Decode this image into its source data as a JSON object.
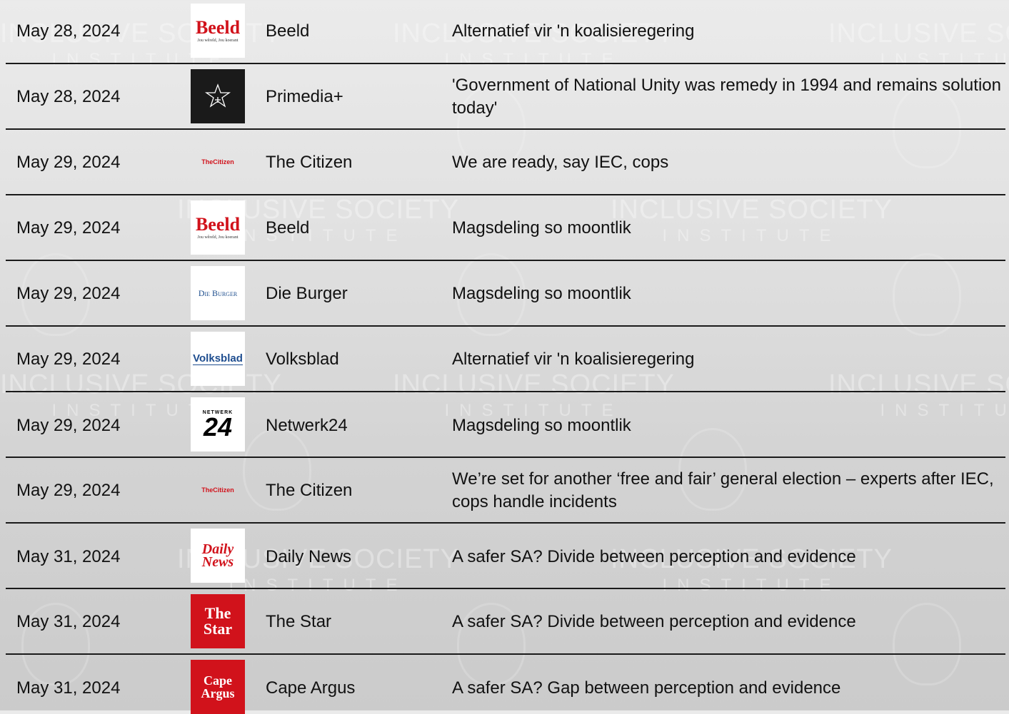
{
  "watermark": {
    "title": "INCLUSIVE SOCIETY",
    "subtitle": "INSTITUTE"
  },
  "rows": [
    {
      "date": "May 28, 2024",
      "source": "Beeld",
      "headline": "Alternatief vir 'n koalisieregering",
      "logo": {
        "line1": "Beeld",
        "line2": "Jou wêreld, Jou koerant"
      }
    },
    {
      "date": "May 28, 2024",
      "source": "Primedia+",
      "headline": "'Government of National Unity was remedy in 1994 and remains solution today'",
      "logo": {}
    },
    {
      "date": "May 29, 2024",
      "source": "The Citizen",
      "headline": "We are ready, say IEC, cops",
      "logo": {
        "line1": "TheCitizen"
      }
    },
    {
      "date": "May 29, 2024",
      "source": "Beeld",
      "headline": "Magsdeling so moontlik",
      "logo": {
        "line1": "Beeld",
        "line2": "Jou wêreld, Jou koerant"
      }
    },
    {
      "date": "May 29, 2024",
      "source": "Die Burger",
      "headline": "Magsdeling so moontlik",
      "logo": {
        "line1": "Die Burger"
      }
    },
    {
      "date": "May 29, 2024",
      "source": "Volksblad",
      "headline": "Alternatief vir 'n koalisieregering",
      "logo": {
        "line1": "Volksblad"
      }
    },
    {
      "date": "May 29, 2024",
      "source": "Netwerk24",
      "headline": "Magsdeling so moontlik",
      "logo": {
        "line1": "NETWERK",
        "line2": "24"
      }
    },
    {
      "date": "May 29, 2024",
      "source": "The Citizen",
      "headline": "We’re set for another ‘free and fair’ general election – experts after IEC, cops handle incidents",
      "logo": {
        "line1": "TheCitizen"
      }
    },
    {
      "date": "May 31, 2024",
      "source": "Daily News",
      "headline": "A safer SA? Divide between perception and evidence",
      "logo": {
        "line1": "Daily",
        "line2": "News"
      }
    },
    {
      "date": "May 31, 2024",
      "source": "The Star",
      "headline": "A safer SA? Divide between perception and evidence",
      "logo": {
        "line1": "The",
        "line2": "Star"
      }
    },
    {
      "date": "May 31, 2024",
      "source": "Cape Argus",
      "headline": "A safer SA? Gap between perception and evidence",
      "logo": {
        "line1": "Cape",
        "line2": "Argus"
      }
    }
  ]
}
